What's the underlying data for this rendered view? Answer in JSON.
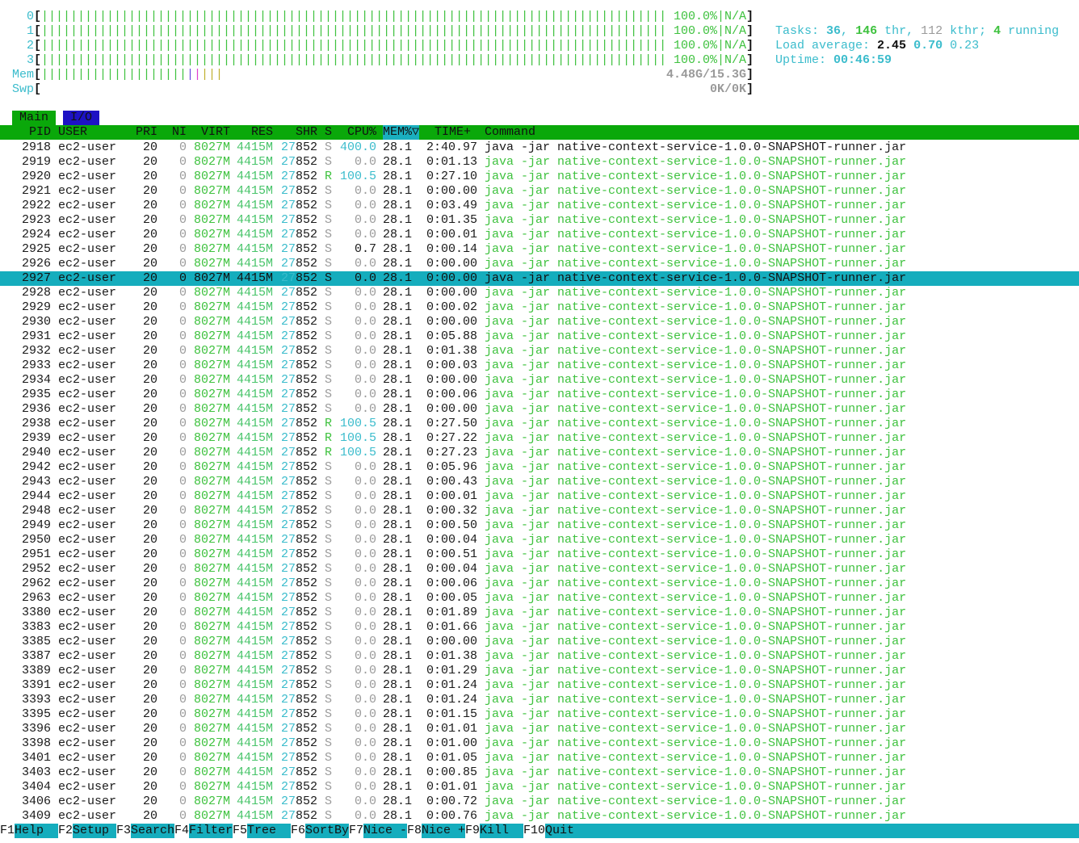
{
  "meters": {
    "cpus": [
      {
        "label": "0",
        "percent_text": "100.0%",
        "extra": "N/A",
        "usage_percent": 100.0
      },
      {
        "label": "1",
        "percent_text": "100.0%",
        "extra": "N/A",
        "usage_percent": 100.0
      },
      {
        "label": "2",
        "percent_text": "100.0%",
        "extra": "N/A",
        "usage_percent": 100.0
      },
      {
        "label": "3",
        "percent_text": "100.0%",
        "extra": "N/A",
        "usage_percent": 100.0
      }
    ],
    "mem": {
      "label": "Mem",
      "value_text": "4.48G/15.3G",
      "used_fraction": 0.293
    },
    "swp": {
      "label": "Swp",
      "value_text": "0K/0K",
      "used_fraction": 0.0
    }
  },
  "summary": {
    "tasks_label": "Tasks: ",
    "tasks": "36",
    "sep1": ", ",
    "threads": "146",
    "thr_label": " thr, ",
    "kthreads": "112",
    "kthr_label": " kthr; ",
    "running": "4",
    "running_label": " running",
    "load_label": "Load average: ",
    "load1": "2.45",
    "load5": "0.70",
    "load15": "0.23",
    "uptime_label": "Uptime: ",
    "uptime": "00:46:59"
  },
  "tabs": [
    {
      "label": "Main",
      "active": true
    },
    {
      "label": "I/O",
      "active": false
    }
  ],
  "columns": {
    "pid": "PID",
    "user": "USER",
    "pri": "PRI",
    "ni": "NI",
    "virt": "VIRT",
    "res": "RES",
    "shr": "SHR",
    "s": "S",
    "cpu": "CPU%",
    "mem": "MEM%▽",
    "time": "TIME+",
    "command": "Command"
  },
  "selected_pid": "2927",
  "processes": [
    {
      "pid": "2918",
      "user": "ec2-user",
      "pri": "20",
      "ni": "0",
      "virt": "8027M",
      "res": "4415M",
      "shr": "27852",
      "s": "S",
      "cpu": "400.0",
      "mem": "28.1",
      "time": "2:40.97",
      "cmd": "java -jar native-context-service-1.0.0-SNAPSHOT-runner.jar",
      "main": true
    },
    {
      "pid": "2919",
      "user": "ec2-user",
      "pri": "20",
      "ni": "0",
      "virt": "8027M",
      "res": "4415M",
      "shr": "27852",
      "s": "S",
      "cpu": "0.0",
      "mem": "28.1",
      "time": "0:01.13",
      "cmd": "java -jar native-context-service-1.0.0-SNAPSHOT-runner.jar"
    },
    {
      "pid": "2920",
      "user": "ec2-user",
      "pri": "20",
      "ni": "0",
      "virt": "8027M",
      "res": "4415M",
      "shr": "27852",
      "s": "R",
      "cpu": "100.5",
      "mem": "28.1",
      "time": "0:27.10",
      "cmd": "java -jar native-context-service-1.0.0-SNAPSHOT-runner.jar"
    },
    {
      "pid": "2921",
      "user": "ec2-user",
      "pri": "20",
      "ni": "0",
      "virt": "8027M",
      "res": "4415M",
      "shr": "27852",
      "s": "S",
      "cpu": "0.0",
      "mem": "28.1",
      "time": "0:00.00",
      "cmd": "java -jar native-context-service-1.0.0-SNAPSHOT-runner.jar"
    },
    {
      "pid": "2922",
      "user": "ec2-user",
      "pri": "20",
      "ni": "0",
      "virt": "8027M",
      "res": "4415M",
      "shr": "27852",
      "s": "S",
      "cpu": "0.0",
      "mem": "28.1",
      "time": "0:03.49",
      "cmd": "java -jar native-context-service-1.0.0-SNAPSHOT-runner.jar"
    },
    {
      "pid": "2923",
      "user": "ec2-user",
      "pri": "20",
      "ni": "0",
      "virt": "8027M",
      "res": "4415M",
      "shr": "27852",
      "s": "S",
      "cpu": "0.0",
      "mem": "28.1",
      "time": "0:01.35",
      "cmd": "java -jar native-context-service-1.0.0-SNAPSHOT-runner.jar"
    },
    {
      "pid": "2924",
      "user": "ec2-user",
      "pri": "20",
      "ni": "0",
      "virt": "8027M",
      "res": "4415M",
      "shr": "27852",
      "s": "S",
      "cpu": "0.0",
      "mem": "28.1",
      "time": "0:00.01",
      "cmd": "java -jar native-context-service-1.0.0-SNAPSHOT-runner.jar"
    },
    {
      "pid": "2925",
      "user": "ec2-user",
      "pri": "20",
      "ni": "0",
      "virt": "8027M",
      "res": "4415M",
      "shr": "27852",
      "s": "S",
      "cpu": "0.7",
      "mem": "28.1",
      "time": "0:00.14",
      "cmd": "java -jar native-context-service-1.0.0-SNAPSHOT-runner.jar"
    },
    {
      "pid": "2926",
      "user": "ec2-user",
      "pri": "20",
      "ni": "0",
      "virt": "8027M",
      "res": "4415M",
      "shr": "27852",
      "s": "S",
      "cpu": "0.0",
      "mem": "28.1",
      "time": "0:00.00",
      "cmd": "java -jar native-context-service-1.0.0-SNAPSHOT-runner.jar"
    },
    {
      "pid": "2927",
      "user": "ec2-user",
      "pri": "20",
      "ni": "0",
      "virt": "8027M",
      "res": "4415M",
      "shr": "27852",
      "s": "S",
      "cpu": "0.0",
      "mem": "28.1",
      "time": "0:00.00",
      "cmd": "java -jar native-context-service-1.0.0-SNAPSHOT-runner.jar"
    },
    {
      "pid": "2928",
      "user": "ec2-user",
      "pri": "20",
      "ni": "0",
      "virt": "8027M",
      "res": "4415M",
      "shr": "27852",
      "s": "S",
      "cpu": "0.0",
      "mem": "28.1",
      "time": "0:00.00",
      "cmd": "java -jar native-context-service-1.0.0-SNAPSHOT-runner.jar"
    },
    {
      "pid": "2929",
      "user": "ec2-user",
      "pri": "20",
      "ni": "0",
      "virt": "8027M",
      "res": "4415M",
      "shr": "27852",
      "s": "S",
      "cpu": "0.0",
      "mem": "28.1",
      "time": "0:00.02",
      "cmd": "java -jar native-context-service-1.0.0-SNAPSHOT-runner.jar"
    },
    {
      "pid": "2930",
      "user": "ec2-user",
      "pri": "20",
      "ni": "0",
      "virt": "8027M",
      "res": "4415M",
      "shr": "27852",
      "s": "S",
      "cpu": "0.0",
      "mem": "28.1",
      "time": "0:00.00",
      "cmd": "java -jar native-context-service-1.0.0-SNAPSHOT-runner.jar"
    },
    {
      "pid": "2931",
      "user": "ec2-user",
      "pri": "20",
      "ni": "0",
      "virt": "8027M",
      "res": "4415M",
      "shr": "27852",
      "s": "S",
      "cpu": "0.0",
      "mem": "28.1",
      "time": "0:05.88",
      "cmd": "java -jar native-context-service-1.0.0-SNAPSHOT-runner.jar"
    },
    {
      "pid": "2932",
      "user": "ec2-user",
      "pri": "20",
      "ni": "0",
      "virt": "8027M",
      "res": "4415M",
      "shr": "27852",
      "s": "S",
      "cpu": "0.0",
      "mem": "28.1",
      "time": "0:01.38",
      "cmd": "java -jar native-context-service-1.0.0-SNAPSHOT-runner.jar"
    },
    {
      "pid": "2933",
      "user": "ec2-user",
      "pri": "20",
      "ni": "0",
      "virt": "8027M",
      "res": "4415M",
      "shr": "27852",
      "s": "S",
      "cpu": "0.0",
      "mem": "28.1",
      "time": "0:00.03",
      "cmd": "java -jar native-context-service-1.0.0-SNAPSHOT-runner.jar"
    },
    {
      "pid": "2934",
      "user": "ec2-user",
      "pri": "20",
      "ni": "0",
      "virt": "8027M",
      "res": "4415M",
      "shr": "27852",
      "s": "S",
      "cpu": "0.0",
      "mem": "28.1",
      "time": "0:00.00",
      "cmd": "java -jar native-context-service-1.0.0-SNAPSHOT-runner.jar"
    },
    {
      "pid": "2935",
      "user": "ec2-user",
      "pri": "20",
      "ni": "0",
      "virt": "8027M",
      "res": "4415M",
      "shr": "27852",
      "s": "S",
      "cpu": "0.0",
      "mem": "28.1",
      "time": "0:00.06",
      "cmd": "java -jar native-context-service-1.0.0-SNAPSHOT-runner.jar"
    },
    {
      "pid": "2936",
      "user": "ec2-user",
      "pri": "20",
      "ni": "0",
      "virt": "8027M",
      "res": "4415M",
      "shr": "27852",
      "s": "S",
      "cpu": "0.0",
      "mem": "28.1",
      "time": "0:00.00",
      "cmd": "java -jar native-context-service-1.0.0-SNAPSHOT-runner.jar"
    },
    {
      "pid": "2938",
      "user": "ec2-user",
      "pri": "20",
      "ni": "0",
      "virt": "8027M",
      "res": "4415M",
      "shr": "27852",
      "s": "R",
      "cpu": "100.5",
      "mem": "28.1",
      "time": "0:27.50",
      "cmd": "java -jar native-context-service-1.0.0-SNAPSHOT-runner.jar"
    },
    {
      "pid": "2939",
      "user": "ec2-user",
      "pri": "20",
      "ni": "0",
      "virt": "8027M",
      "res": "4415M",
      "shr": "27852",
      "s": "R",
      "cpu": "100.5",
      "mem": "28.1",
      "time": "0:27.22",
      "cmd": "java -jar native-context-service-1.0.0-SNAPSHOT-runner.jar"
    },
    {
      "pid": "2940",
      "user": "ec2-user",
      "pri": "20",
      "ni": "0",
      "virt": "8027M",
      "res": "4415M",
      "shr": "27852",
      "s": "R",
      "cpu": "100.5",
      "mem": "28.1",
      "time": "0:27.23",
      "cmd": "java -jar native-context-service-1.0.0-SNAPSHOT-runner.jar"
    },
    {
      "pid": "2942",
      "user": "ec2-user",
      "pri": "20",
      "ni": "0",
      "virt": "8027M",
      "res": "4415M",
      "shr": "27852",
      "s": "S",
      "cpu": "0.0",
      "mem": "28.1",
      "time": "0:05.96",
      "cmd": "java -jar native-context-service-1.0.0-SNAPSHOT-runner.jar"
    },
    {
      "pid": "2943",
      "user": "ec2-user",
      "pri": "20",
      "ni": "0",
      "virt": "8027M",
      "res": "4415M",
      "shr": "27852",
      "s": "S",
      "cpu": "0.0",
      "mem": "28.1",
      "time": "0:00.43",
      "cmd": "java -jar native-context-service-1.0.0-SNAPSHOT-runner.jar"
    },
    {
      "pid": "2944",
      "user": "ec2-user",
      "pri": "20",
      "ni": "0",
      "virt": "8027M",
      "res": "4415M",
      "shr": "27852",
      "s": "S",
      "cpu": "0.0",
      "mem": "28.1",
      "time": "0:00.01",
      "cmd": "java -jar native-context-service-1.0.0-SNAPSHOT-runner.jar"
    },
    {
      "pid": "2948",
      "user": "ec2-user",
      "pri": "20",
      "ni": "0",
      "virt": "8027M",
      "res": "4415M",
      "shr": "27852",
      "s": "S",
      "cpu": "0.0",
      "mem": "28.1",
      "time": "0:00.32",
      "cmd": "java -jar native-context-service-1.0.0-SNAPSHOT-runner.jar"
    },
    {
      "pid": "2949",
      "user": "ec2-user",
      "pri": "20",
      "ni": "0",
      "virt": "8027M",
      "res": "4415M",
      "shr": "27852",
      "s": "S",
      "cpu": "0.0",
      "mem": "28.1",
      "time": "0:00.50",
      "cmd": "java -jar native-context-service-1.0.0-SNAPSHOT-runner.jar"
    },
    {
      "pid": "2950",
      "user": "ec2-user",
      "pri": "20",
      "ni": "0",
      "virt": "8027M",
      "res": "4415M",
      "shr": "27852",
      "s": "S",
      "cpu": "0.0",
      "mem": "28.1",
      "time": "0:00.04",
      "cmd": "java -jar native-context-service-1.0.0-SNAPSHOT-runner.jar"
    },
    {
      "pid": "2951",
      "user": "ec2-user",
      "pri": "20",
      "ni": "0",
      "virt": "8027M",
      "res": "4415M",
      "shr": "27852",
      "s": "S",
      "cpu": "0.0",
      "mem": "28.1",
      "time": "0:00.51",
      "cmd": "java -jar native-context-service-1.0.0-SNAPSHOT-runner.jar"
    },
    {
      "pid": "2952",
      "user": "ec2-user",
      "pri": "20",
      "ni": "0",
      "virt": "8027M",
      "res": "4415M",
      "shr": "27852",
      "s": "S",
      "cpu": "0.0",
      "mem": "28.1",
      "time": "0:00.04",
      "cmd": "java -jar native-context-service-1.0.0-SNAPSHOT-runner.jar"
    },
    {
      "pid": "2962",
      "user": "ec2-user",
      "pri": "20",
      "ni": "0",
      "virt": "8027M",
      "res": "4415M",
      "shr": "27852",
      "s": "S",
      "cpu": "0.0",
      "mem": "28.1",
      "time": "0:00.06",
      "cmd": "java -jar native-context-service-1.0.0-SNAPSHOT-runner.jar"
    },
    {
      "pid": "2963",
      "user": "ec2-user",
      "pri": "20",
      "ni": "0",
      "virt": "8027M",
      "res": "4415M",
      "shr": "27852",
      "s": "S",
      "cpu": "0.0",
      "mem": "28.1",
      "time": "0:00.05",
      "cmd": "java -jar native-context-service-1.0.0-SNAPSHOT-runner.jar"
    },
    {
      "pid": "3380",
      "user": "ec2-user",
      "pri": "20",
      "ni": "0",
      "virt": "8027M",
      "res": "4415M",
      "shr": "27852",
      "s": "S",
      "cpu": "0.0",
      "mem": "28.1",
      "time": "0:01.89",
      "cmd": "java -jar native-context-service-1.0.0-SNAPSHOT-runner.jar"
    },
    {
      "pid": "3383",
      "user": "ec2-user",
      "pri": "20",
      "ni": "0",
      "virt": "8027M",
      "res": "4415M",
      "shr": "27852",
      "s": "S",
      "cpu": "0.0",
      "mem": "28.1",
      "time": "0:01.66",
      "cmd": "java -jar native-context-service-1.0.0-SNAPSHOT-runner.jar"
    },
    {
      "pid": "3385",
      "user": "ec2-user",
      "pri": "20",
      "ni": "0",
      "virt": "8027M",
      "res": "4415M",
      "shr": "27852",
      "s": "S",
      "cpu": "0.0",
      "mem": "28.1",
      "time": "0:00.00",
      "cmd": "java -jar native-context-service-1.0.0-SNAPSHOT-runner.jar"
    },
    {
      "pid": "3387",
      "user": "ec2-user",
      "pri": "20",
      "ni": "0",
      "virt": "8027M",
      "res": "4415M",
      "shr": "27852",
      "s": "S",
      "cpu": "0.0",
      "mem": "28.1",
      "time": "0:01.38",
      "cmd": "java -jar native-context-service-1.0.0-SNAPSHOT-runner.jar"
    },
    {
      "pid": "3389",
      "user": "ec2-user",
      "pri": "20",
      "ni": "0",
      "virt": "8027M",
      "res": "4415M",
      "shr": "27852",
      "s": "S",
      "cpu": "0.0",
      "mem": "28.1",
      "time": "0:01.29",
      "cmd": "java -jar native-context-service-1.0.0-SNAPSHOT-runner.jar"
    },
    {
      "pid": "3391",
      "user": "ec2-user",
      "pri": "20",
      "ni": "0",
      "virt": "8027M",
      "res": "4415M",
      "shr": "27852",
      "s": "S",
      "cpu": "0.0",
      "mem": "28.1",
      "time": "0:01.24",
      "cmd": "java -jar native-context-service-1.0.0-SNAPSHOT-runner.jar"
    },
    {
      "pid": "3393",
      "user": "ec2-user",
      "pri": "20",
      "ni": "0",
      "virt": "8027M",
      "res": "4415M",
      "shr": "27852",
      "s": "S",
      "cpu": "0.0",
      "mem": "28.1",
      "time": "0:01.24",
      "cmd": "java -jar native-context-service-1.0.0-SNAPSHOT-runner.jar"
    },
    {
      "pid": "3395",
      "user": "ec2-user",
      "pri": "20",
      "ni": "0",
      "virt": "8027M",
      "res": "4415M",
      "shr": "27852",
      "s": "S",
      "cpu": "0.0",
      "mem": "28.1",
      "time": "0:01.15",
      "cmd": "java -jar native-context-service-1.0.0-SNAPSHOT-runner.jar"
    },
    {
      "pid": "3396",
      "user": "ec2-user",
      "pri": "20",
      "ni": "0",
      "virt": "8027M",
      "res": "4415M",
      "shr": "27852",
      "s": "S",
      "cpu": "0.0",
      "mem": "28.1",
      "time": "0:01.01",
      "cmd": "java -jar native-context-service-1.0.0-SNAPSHOT-runner.jar"
    },
    {
      "pid": "3398",
      "user": "ec2-user",
      "pri": "20",
      "ni": "0",
      "virt": "8027M",
      "res": "4415M",
      "shr": "27852",
      "s": "S",
      "cpu": "0.0",
      "mem": "28.1",
      "time": "0:01.00",
      "cmd": "java -jar native-context-service-1.0.0-SNAPSHOT-runner.jar"
    },
    {
      "pid": "3401",
      "user": "ec2-user",
      "pri": "20",
      "ni": "0",
      "virt": "8027M",
      "res": "4415M",
      "shr": "27852",
      "s": "S",
      "cpu": "0.0",
      "mem": "28.1",
      "time": "0:01.05",
      "cmd": "java -jar native-context-service-1.0.0-SNAPSHOT-runner.jar"
    },
    {
      "pid": "3403",
      "user": "ec2-user",
      "pri": "20",
      "ni": "0",
      "virt": "8027M",
      "res": "4415M",
      "shr": "27852",
      "s": "S",
      "cpu": "0.0",
      "mem": "28.1",
      "time": "0:00.85",
      "cmd": "java -jar native-context-service-1.0.0-SNAPSHOT-runner.jar"
    },
    {
      "pid": "3404",
      "user": "ec2-user",
      "pri": "20",
      "ni": "0",
      "virt": "8027M",
      "res": "4415M",
      "shr": "27852",
      "s": "S",
      "cpu": "0.0",
      "mem": "28.1",
      "time": "0:01.01",
      "cmd": "java -jar native-context-service-1.0.0-SNAPSHOT-runner.jar"
    },
    {
      "pid": "3406",
      "user": "ec2-user",
      "pri": "20",
      "ni": "0",
      "virt": "8027M",
      "res": "4415M",
      "shr": "27852",
      "s": "S",
      "cpu": "0.0",
      "mem": "28.1",
      "time": "0:00.72",
      "cmd": "java -jar native-context-service-1.0.0-SNAPSHOT-runner.jar"
    },
    {
      "pid": "3409",
      "user": "ec2-user",
      "pri": "20",
      "ni": "0",
      "virt": "8027M",
      "res": "4415M",
      "shr": "27852",
      "s": "S",
      "cpu": "0.0",
      "mem": "28.1",
      "time": "0:00.76",
      "cmd": "java -jar native-context-service-1.0.0-SNAPSHOT-runner.jar"
    }
  ],
  "footer": [
    {
      "key": "F1",
      "label": "Help  "
    },
    {
      "key": "F2",
      "label": "Setup "
    },
    {
      "key": "F3",
      "label": "Search"
    },
    {
      "key": "F4",
      "label": "Filter"
    },
    {
      "key": "F5",
      "label": "Tree  "
    },
    {
      "key": "F6",
      "label": "SortBy"
    },
    {
      "key": "F7",
      "label": "Nice -"
    },
    {
      "key": "F8",
      "label": "Nice +"
    },
    {
      "key": "F9",
      "label": "Kill  "
    },
    {
      "key": "F10",
      "label": "Quit  "
    }
  ],
  "colors": {
    "header_bg": "#0aa80a",
    "selected_bg": "#15adbd",
    "tab_io_bg": "#1d12c4",
    "green": "#3fc23f",
    "cyan": "#3bbccc",
    "grey": "#9a9a9a"
  }
}
